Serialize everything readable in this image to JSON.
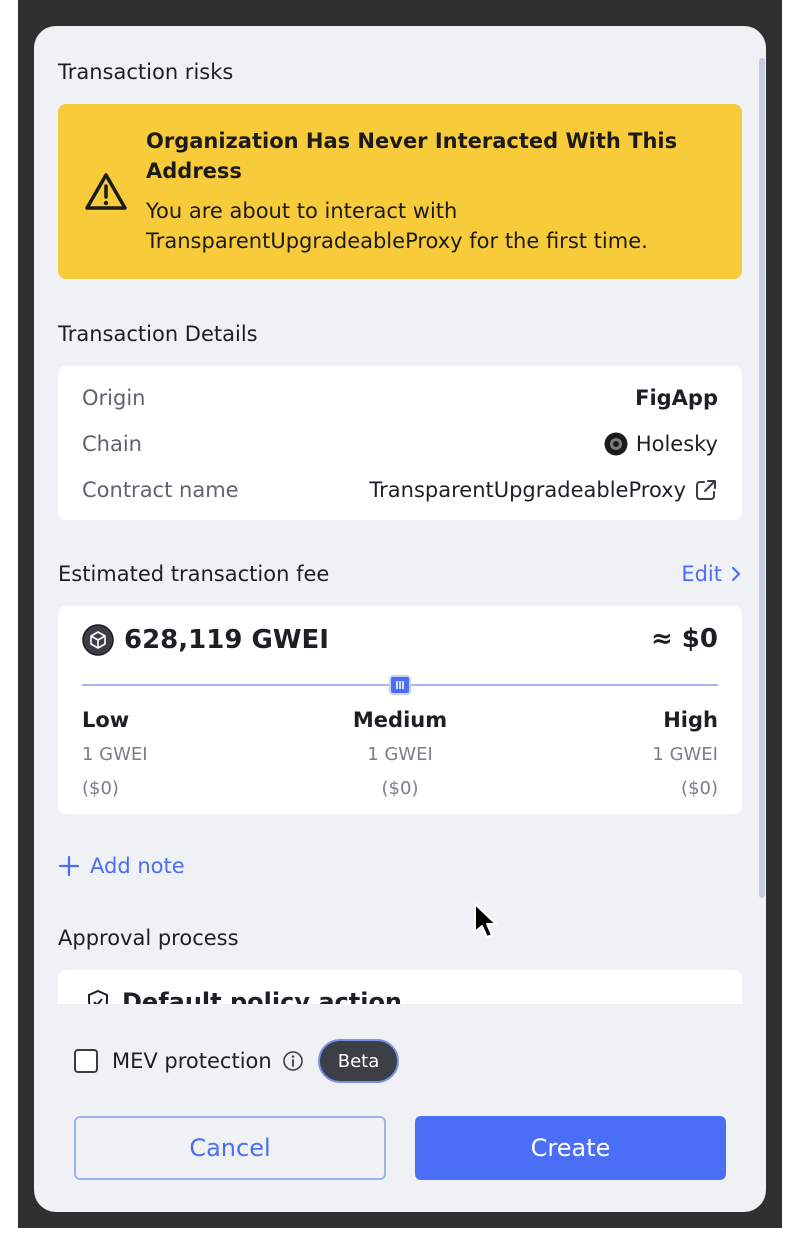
{
  "sections": {
    "risks_title": "Transaction risks",
    "details_title": "Transaction Details",
    "fee_title": "Estimated transaction fee",
    "approval_title": "Approval process"
  },
  "risk": {
    "title": "Organization Has Never Interacted With This Address",
    "body": "You are about to interact with TransparentUpgradeableProxy for the first time.",
    "icon": "warning-triangle-icon",
    "color": "#f8cb3a"
  },
  "details": [
    {
      "label": "Origin",
      "value": "FigApp"
    },
    {
      "label": "Chain",
      "value": "Holesky"
    },
    {
      "label": "Contract name",
      "value": "TransparentUpgradeableProxy"
    }
  ],
  "fee": {
    "edit_label": "Edit",
    "amount": "628,119 GWEI",
    "usd": "≈ $0",
    "slider_level": 0.5,
    "tiers": [
      {
        "name": "Low",
        "gwei": "1 GWEI",
        "usd": "($0)"
      },
      {
        "name": "Medium",
        "gwei": "1 GWEI",
        "usd": "($0)"
      },
      {
        "name": "High",
        "gwei": "1 GWEI",
        "usd": "($0)"
      }
    ]
  },
  "add_note_label": "Add note",
  "policy": {
    "label": "Default policy action"
  },
  "footer": {
    "mev_label": "MEV protection",
    "beta_label": "Beta",
    "cancel_label": "Cancel",
    "create_label": "Create"
  },
  "colors": {
    "accent": "#4a6ef5",
    "panel": "#f0f1f5",
    "backdrop": "#2f2f2f"
  }
}
